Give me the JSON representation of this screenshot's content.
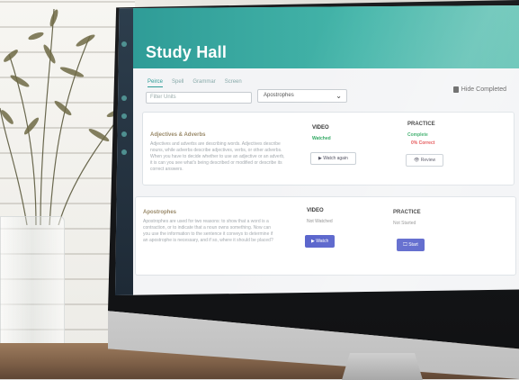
{
  "app": {
    "title": "Study Hall"
  },
  "tabs": [
    {
      "label": "Peirce"
    },
    {
      "label": "Spell"
    },
    {
      "label": "Grammar"
    },
    {
      "label": "Screen"
    }
  ],
  "filter": {
    "search_placeholder": "Filter Units",
    "select_value": "Apostrophes",
    "hide_completed_label": "Hide Completed"
  },
  "lessons": [
    {
      "title": "Adjectives & Adverbs",
      "description": "Adjectives and adverbs are describing words. Adjectives describe nouns, while adverbs describe adjectives, verbs, or other adverbs. When you have to decide whether to use an adjective or an adverb, it is can you see what's being described or modified or describe its correct answers.",
      "video_head": "VIDEO",
      "video_status": "Watched",
      "video_button": "Watch again",
      "practice_head": "PRACTICE",
      "practice_status": "Complete",
      "practice_score": "0% Correct",
      "practice_button": "Review"
    },
    {
      "title": "Apostrophes",
      "description": "Apostrophes are used for two reasons: to show that a word is a contraction, or to indicate that a noun owns something. Now can you use the information to the sentence it conveys to determine if an apostrophe is necessary, and if so, where it should be placed?",
      "video_head": "VIDEO",
      "video_status": "Not Watched",
      "video_button": "Watch",
      "practice_head": "PRACTICE",
      "practice_status": "Not Started",
      "practice_button": "Start"
    }
  ],
  "colors": {
    "header": "#3aa9a1",
    "primary_button": "#4a56c7",
    "complete": "#27a55b",
    "score": "#e0393b"
  }
}
